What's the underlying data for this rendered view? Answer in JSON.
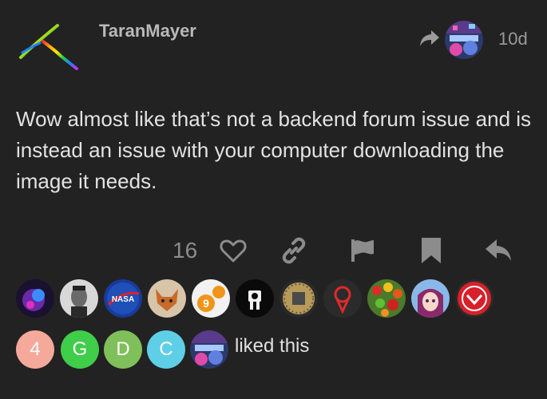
{
  "post": {
    "username": "TaranMayer",
    "age": "10d",
    "body": "Wow almost like that’s not a backend forum issue and is instead an issue with your computer downloading the image it needs."
  },
  "actions": {
    "like_count": "16",
    "icons": [
      "heart-icon",
      "link-icon",
      "flag-icon",
      "bookmark-icon",
      "reply-icon"
    ]
  },
  "likers": {
    "avatar_icons": [
      "nebula-avatar",
      "tesla-avatar",
      "nasa-avatar",
      "fox-avatar",
      "sudoku-avatar",
      "robot-avatar",
      "chip-avatar",
      "pin-avatar",
      "candy-avatar",
      "anime-avatar",
      "badge-avatar"
    ],
    "nasa_text": "NASA",
    "sudoku_text": "9",
    "letter_avatars": [
      {
        "letter": "4",
        "color": "#f4a99b"
      },
      {
        "letter": "G",
        "color": "#3fcd4a"
      },
      {
        "letter": "D",
        "color": "#7fc05a"
      },
      {
        "letter": "C",
        "color": "#5ecfe6"
      }
    ],
    "liked_text": "liked this"
  },
  "colors": {
    "background": "#222222",
    "icon_gray": "#8c8c8c"
  }
}
